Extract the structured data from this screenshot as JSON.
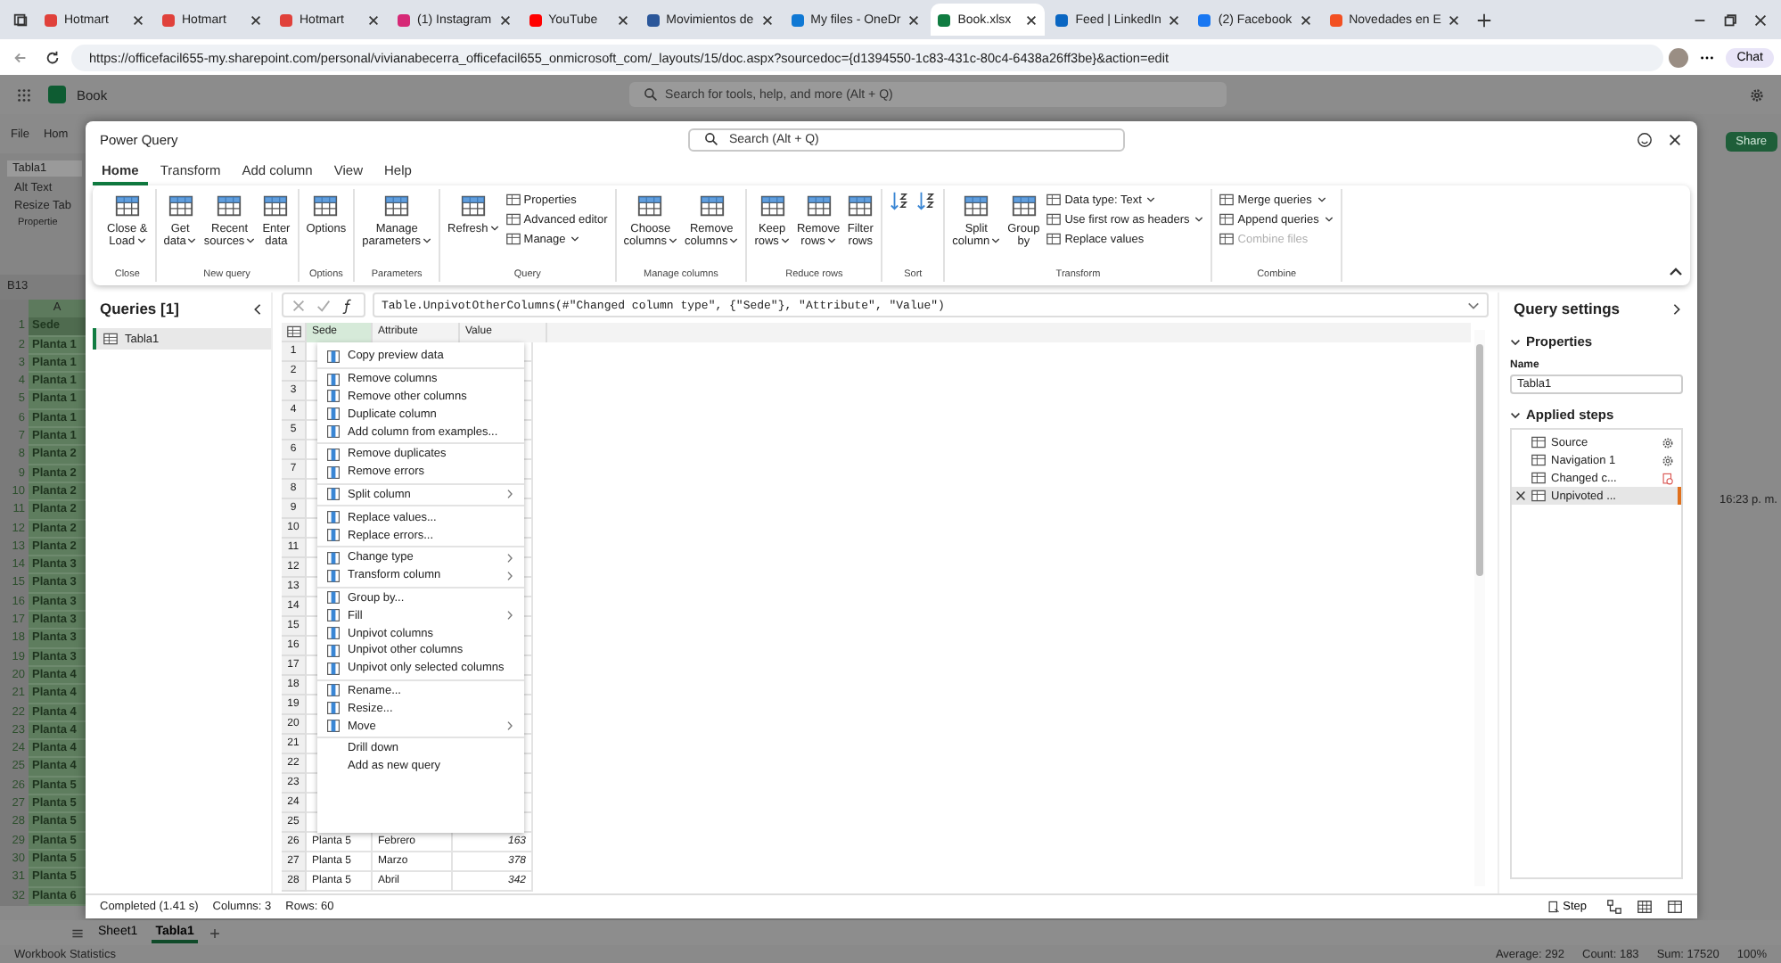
{
  "browser": {
    "tabs": [
      {
        "title": "Hotmart",
        "color": "#e0413b",
        "selected": false
      },
      {
        "title": "Hotmart",
        "color": "#e0413b",
        "selected": false
      },
      {
        "title": "Hotmart",
        "color": "#e0413b",
        "selected": false
      },
      {
        "title": "(1) Instagram",
        "color": "#d62976",
        "selected": false
      },
      {
        "title": "YouTube",
        "color": "#ff0000",
        "selected": false
      },
      {
        "title": "Movimientos de",
        "color": "#2b579a",
        "selected": false
      },
      {
        "title": "My files - OneDr",
        "color": "#0f78d4",
        "selected": false
      },
      {
        "title": "Book.xlsx",
        "color": "#107c41",
        "selected": true
      },
      {
        "title": "Feed | LinkedIn",
        "color": "#0a66c2",
        "selected": false
      },
      {
        "title": "(2) Facebook",
        "color": "#1877f2",
        "selected": false
      },
      {
        "title": "Novedades en E",
        "color": "#f25022",
        "selected": false
      }
    ],
    "address": "https://officefacil655-my.sharepoint.com/personal/vivianabecerra_officefacil655_onmicrosoft_com/_layouts/15/doc.aspx?sourcedoc={d1394550-1c83-431c-80c4-6438a26ff3be}&action=edit",
    "chat_button": "Chat"
  },
  "excel": {
    "app_name": "Book",
    "search_placeholder": "Search for tools, help, and more (Alt + Q)",
    "menu": [
      "File",
      "Hom"
    ],
    "table_name": "Tabla1",
    "ribbon_items": [
      "Alt Text",
      "Resize Tab"
    ],
    "group_label": "Propertie",
    "name_box": "B13",
    "column_header": "A",
    "rows": [
      {
        "number": "1",
        "cell": "Sede"
      },
      {
        "number": "2",
        "cell": "Planta 1"
      },
      {
        "number": "3",
        "cell": "Planta 1"
      },
      {
        "number": "4",
        "cell": "Planta 1"
      },
      {
        "number": "5",
        "cell": "Planta 1"
      },
      {
        "number": "6",
        "cell": "Planta 1"
      },
      {
        "number": "7",
        "cell": "Planta 1"
      },
      {
        "number": "8",
        "cell": "Planta 2"
      },
      {
        "number": "9",
        "cell": "Planta 2"
      },
      {
        "number": "10",
        "cell": "Planta 2"
      },
      {
        "number": "11",
        "cell": "Planta 2"
      },
      {
        "number": "12",
        "cell": "Planta 2"
      },
      {
        "number": "13",
        "cell": "Planta 2"
      },
      {
        "number": "14",
        "cell": "Planta 3"
      },
      {
        "number": "15",
        "cell": "Planta 3"
      },
      {
        "number": "16",
        "cell": "Planta 3"
      },
      {
        "number": "17",
        "cell": "Planta 3"
      },
      {
        "number": "18",
        "cell": "Planta 3"
      },
      {
        "number": "19",
        "cell": "Planta 3"
      },
      {
        "number": "20",
        "cell": "Planta 4"
      },
      {
        "number": "21",
        "cell": "Planta 4"
      },
      {
        "number": "22",
        "cell": "Planta 4"
      },
      {
        "number": "23",
        "cell": "Planta 4"
      },
      {
        "number": "24",
        "cell": "Planta 4"
      },
      {
        "number": "25",
        "cell": "Planta 4"
      },
      {
        "number": "26",
        "cell": "Planta 5"
      },
      {
        "number": "27",
        "cell": "Planta 5"
      },
      {
        "number": "28",
        "cell": "Planta 5"
      },
      {
        "number": "29",
        "cell": "Planta 5"
      },
      {
        "number": "30",
        "cell": "Planta 5"
      },
      {
        "number": "31",
        "cell": "Planta 5"
      },
      {
        "number": "32",
        "cell": "Planta 6"
      }
    ],
    "share_button": "Share",
    "side_time": "16:23 p. m.",
    "sheets": [
      {
        "label": "Sheet1",
        "selected": false
      },
      {
        "label": "Tabla1",
        "selected": true
      }
    ],
    "status_label": "Workbook Statistics",
    "stats": [
      "Average: 292",
      "Count: 183",
      "Sum: 17520"
    ],
    "zoom": "100%"
  },
  "power_query": {
    "title": "Power Query",
    "search_placeholder": "Search (Alt + Q)",
    "tabs": [
      {
        "label": "Home",
        "selected": true
      },
      {
        "label": "Transform",
        "selected": false
      },
      {
        "label": "Add column",
        "selected": false
      },
      {
        "label": "View",
        "selected": false
      },
      {
        "label": "Help",
        "selected": false
      }
    ],
    "ribbon_groups": [
      {
        "label": "Close",
        "buttons": [
          {
            "kind": "large",
            "label": "Close &\nLoad",
            "dropdown": true,
            "disabled": false
          }
        ]
      },
      {
        "label": "New query",
        "buttons": [
          {
            "kind": "large",
            "label": "Get\ndata",
            "dropdown": true,
            "disabled": false
          },
          {
            "kind": "large",
            "label": "Recent\nsources",
            "dropdown": true,
            "disabled": false
          },
          {
            "kind": "large",
            "label": "Enter\ndata",
            "dropdown": false,
            "disabled": false
          }
        ]
      },
      {
        "label": "Options",
        "buttons": [
          {
            "kind": "large",
            "label": "Options",
            "dropdown": false,
            "disabled": false
          }
        ]
      },
      {
        "label": "Parameters",
        "buttons": [
          {
            "kind": "large",
            "label": "Manage\nparameters",
            "dropdown": true,
            "disabled": false
          }
        ]
      },
      {
        "label": "Query",
        "buttons": [
          {
            "kind": "large",
            "label": "Refresh",
            "dropdown": true,
            "disabled": false
          },
          {
            "kind": "small",
            "label": "Properties",
            "dropdown": false,
            "disabled": false
          },
          {
            "kind": "small",
            "label": "Advanced editor",
            "dropdown": false,
            "disabled": false
          },
          {
            "kind": "small",
            "label": "Manage",
            "dropdown": true,
            "disabled": false
          }
        ]
      },
      {
        "label": "Manage columns",
        "buttons": [
          {
            "kind": "large",
            "label": "Choose\ncolumns",
            "dropdown": true,
            "disabled": false
          },
          {
            "kind": "large",
            "label": "Remove\ncolumns",
            "dropdown": true,
            "disabled": false
          }
        ]
      },
      {
        "label": "Reduce rows",
        "buttons": [
          {
            "kind": "large",
            "label": "Keep\nrows",
            "dropdown": true,
            "disabled": false
          },
          {
            "kind": "large",
            "label": "Remove\nrows",
            "dropdown": true,
            "disabled": false
          },
          {
            "kind": "large",
            "label": "Filter\nrows",
            "dropdown": false,
            "disabled": false
          }
        ]
      },
      {
        "label": "Sort",
        "buttons": [
          {
            "kind": "sort",
            "dropdown": false,
            "disabled": false
          },
          {
            "kind": "sort",
            "dropdown": false,
            "disabled": false
          }
        ]
      },
      {
        "label": "Transform",
        "buttons": [
          {
            "kind": "large",
            "label": "Split\ncolumn",
            "dropdown": true,
            "disabled": false
          },
          {
            "kind": "large",
            "label": "Group\nby",
            "dropdown": false,
            "disabled": false
          },
          {
            "kind": "small",
            "label": "Data type: Text",
            "dropdown": true,
            "disabled": false
          },
          {
            "kind": "small",
            "label": "Use first row as headers",
            "dropdown": true,
            "disabled": false
          },
          {
            "kind": "small",
            "label": "Replace values",
            "dropdown": false,
            "disabled": false
          }
        ]
      },
      {
        "label": "Combine",
        "buttons": [
          {
            "kind": "small",
            "label": "Merge queries",
            "dropdown": true,
            "disabled": false
          },
          {
            "kind": "small",
            "label": "Append queries",
            "dropdown": true,
            "disabled": false
          },
          {
            "kind": "small",
            "label": "Combine files",
            "dropdown": false,
            "disabled": true
          }
        ]
      }
    ],
    "queries": {
      "title": "Queries [1]",
      "items": [
        {
          "label": "Tabla1",
          "selected": true
        }
      ]
    },
    "formula": "Table.UnpivotOtherColumns(#\"Changed column type\", {\"Sede\"}, \"Attribute\", \"Value\")",
    "table": {
      "columns": [
        "Sede",
        "Attribute",
        "Value"
      ],
      "rows": [
        {
          "number": "1"
        },
        {
          "number": "2"
        },
        {
          "number": "3"
        },
        {
          "number": "4"
        },
        {
          "number": "5"
        },
        {
          "number": "6"
        },
        {
          "number": "7"
        },
        {
          "number": "8"
        },
        {
          "number": "9"
        },
        {
          "number": "10"
        },
        {
          "number": "11"
        },
        {
          "number": "12"
        },
        {
          "number": "13"
        },
        {
          "number": "14"
        },
        {
          "number": "15"
        },
        {
          "number": "16"
        },
        {
          "number": "17"
        },
        {
          "number": "18"
        },
        {
          "number": "19"
        },
        {
          "number": "20"
        },
        {
          "number": "21"
        },
        {
          "number": "22"
        },
        {
          "number": "23"
        },
        {
          "number": "24"
        },
        {
          "number": "25"
        },
        {
          "number": "26",
          "cells": [
            "Planta 5",
            "Febrero",
            "163"
          ]
        },
        {
          "number": "27",
          "cells": [
            "Planta 5",
            "Marzo",
            "378"
          ]
        },
        {
          "number": "28",
          "cells": [
            "Planta 5",
            "Abril",
            "342"
          ]
        }
      ]
    },
    "context_menu": [
      [
        {
          "label": "Copy preview data",
          "kind": "icon",
          "submenu": false
        }
      ],
      [
        {
          "label": "Remove columns",
          "kind": "icon",
          "submenu": false
        },
        {
          "label": "Remove other columns",
          "kind": "icon",
          "submenu": false
        },
        {
          "label": "Duplicate column",
          "kind": "icon",
          "submenu": false
        },
        {
          "label": "Add column from examples...",
          "kind": "icon",
          "submenu": false
        }
      ],
      [
        {
          "label": "Remove duplicates",
          "kind": "icon",
          "submenu": false
        },
        {
          "label": "Remove errors",
          "kind": "icon",
          "submenu": false
        }
      ],
      [
        {
          "label": "Split column",
          "kind": "icon",
          "submenu": true
        }
      ],
      [
        {
          "label": "Replace values...",
          "kind": "icon",
          "submenu": false
        },
        {
          "label": "Replace errors...",
          "kind": "icon",
          "submenu": false
        }
      ],
      [
        {
          "label": "Change type",
          "kind": "icon",
          "submenu": true
        },
        {
          "label": "Transform column",
          "kind": "icon",
          "submenu": true
        }
      ],
      [
        {
          "label": "Group by...",
          "kind": "icon",
          "submenu": false
        },
        {
          "label": "Fill",
          "kind": "icon",
          "submenu": true
        },
        {
          "label": "Unpivot columns",
          "kind": "icon",
          "submenu": false
        },
        {
          "label": "Unpivot other columns",
          "kind": "icon",
          "submenu": false
        },
        {
          "label": "Unpivot only selected columns",
          "kind": "icon",
          "submenu": false
        }
      ],
      [
        {
          "label": "Rename...",
          "kind": "icon",
          "submenu": false
        },
        {
          "label": "Resize...",
          "kind": "icon",
          "submenu": false
        },
        {
          "label": "Move",
          "kind": "icon",
          "submenu": true
        }
      ],
      [
        {
          "label": "Drill down",
          "kind": "text",
          "submenu": false
        },
        {
          "label": "Add as new query",
          "kind": "text",
          "submenu": false
        }
      ]
    ],
    "settings": {
      "title": "Query settings",
      "properties_heading": "Properties",
      "name_label": "Name",
      "name_value": "Tabla1",
      "steps_heading": "Applied steps",
      "steps": [
        {
          "label": "Source",
          "settings": true,
          "warning": false,
          "selected": false
        },
        {
          "label": "Navigation 1",
          "settings": true,
          "warning": false,
          "selected": false
        },
        {
          "label": "Changed c...",
          "settings": false,
          "warning": true,
          "selected": false
        },
        {
          "label": "Unpivoted ...",
          "settings": false,
          "warning": false,
          "selected": true
        }
      ]
    },
    "status": [
      "Completed (1.41 s)",
      "Columns: 3",
      "Rows: 60"
    ],
    "step_button": "Step"
  }
}
